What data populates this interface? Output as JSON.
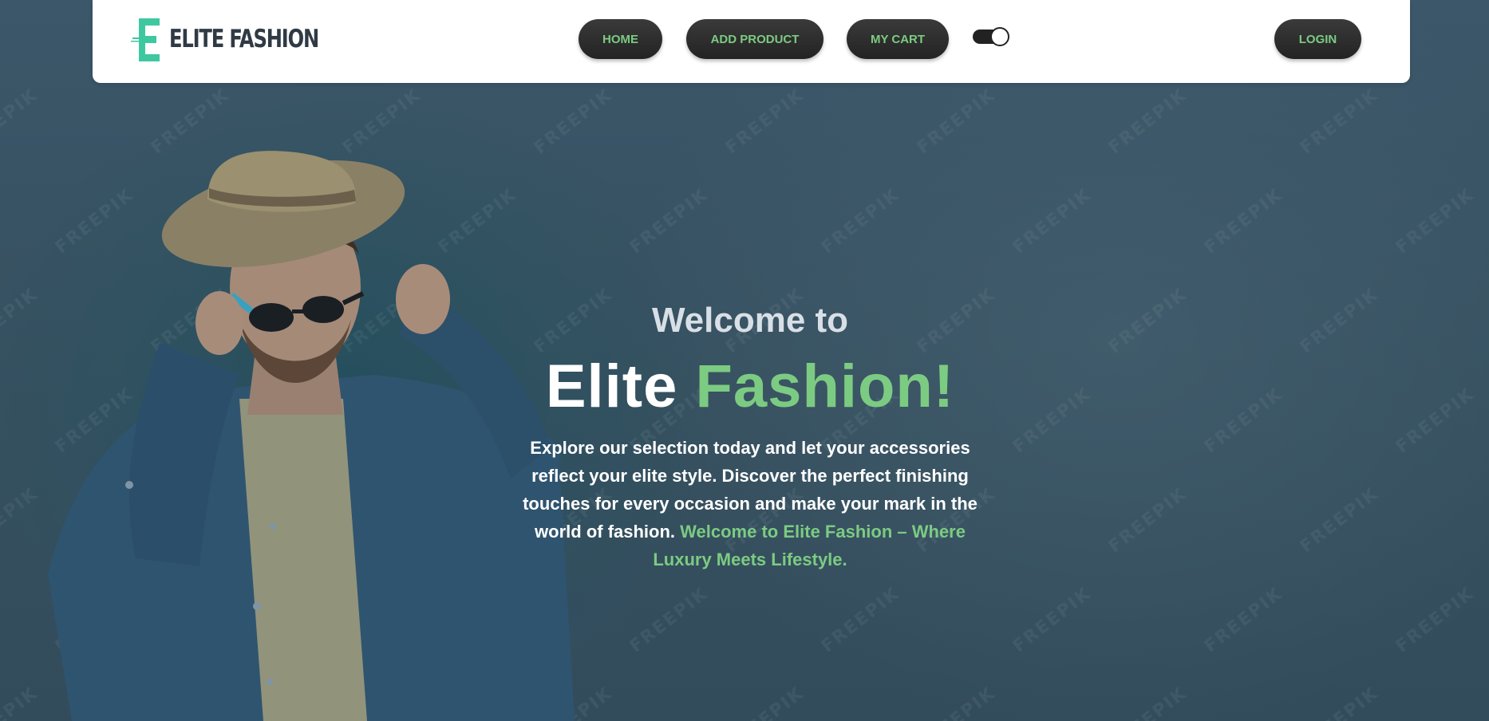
{
  "brand": {
    "logo_letter": "E",
    "name": "ELITE FASHION"
  },
  "nav": {
    "home": "HOME",
    "add_product": "ADD PRODUCT",
    "my_cart": "MY CART",
    "login": "LOGIN",
    "theme_toggle": "on"
  },
  "hero": {
    "welcome": "Welcome to",
    "title_part1": "Elite",
    "title_part2": "Fashion!",
    "description": "Explore our selection today and let your accessories reflect your elite style. Discover the perfect finishing touches for every occasion and make your mark in the world of fashion.",
    "tagline": "Welcome to Elite Fashion – Where Luxury Meets Lifestyle.",
    "watermark": "FREEPIK"
  },
  "colors": {
    "accent": "#7ccb82",
    "button_bg": "#2a2a2a",
    "hero_bg": "#3a5566",
    "logo_teal": "#3ec8a0"
  }
}
